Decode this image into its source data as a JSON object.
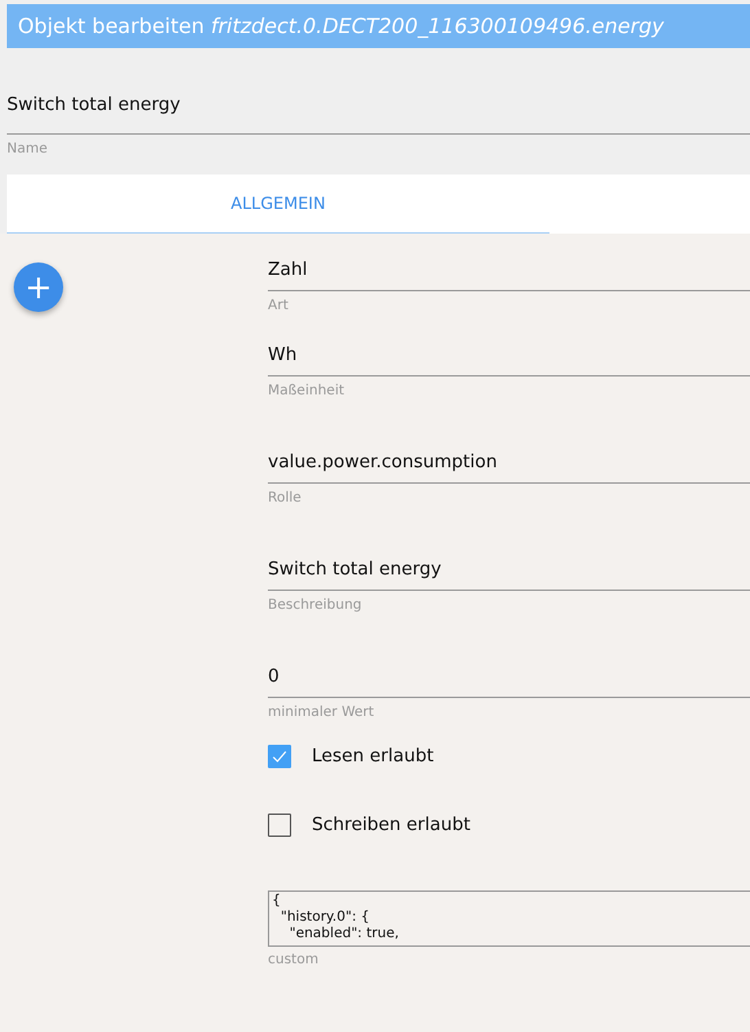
{
  "window": {
    "title": "Objekt bearbeiten *fritzdect.0.DECT200_116300109496.energy*"
  },
  "name_field": {
    "value": "Switch total energy",
    "label": "Name"
  },
  "tabs": [
    {
      "label": "ALLGEMEIN",
      "selected": true
    }
  ],
  "add_button": {
    "label": "+"
  },
  "fields": [
    {
      "kind": "text",
      "value": "Zahl",
      "label": "Art"
    },
    {
      "kind": "text",
      "value": "Wh",
      "label": "Maßeinheit"
    },
    {
      "kind": "text",
      "value": "value.power.consumption",
      "label": "Rolle"
    },
    {
      "kind": "text",
      "value": "Switch total energy",
      "label": "Beschreibung"
    },
    {
      "kind": "text",
      "value": "0",
      "label": "minimaler Wert"
    },
    {
      "kind": "checkbox",
      "label": "Lesen erlaubt",
      "checked": true
    },
    {
      "kind": "checkbox",
      "label": "Schreiben erlaubt",
      "checked": false
    },
    {
      "kind": "textarea",
      "value": "{\n  \"history.0\": {\n    \"enabled\": true,",
      "label": "custom"
    }
  ]
}
